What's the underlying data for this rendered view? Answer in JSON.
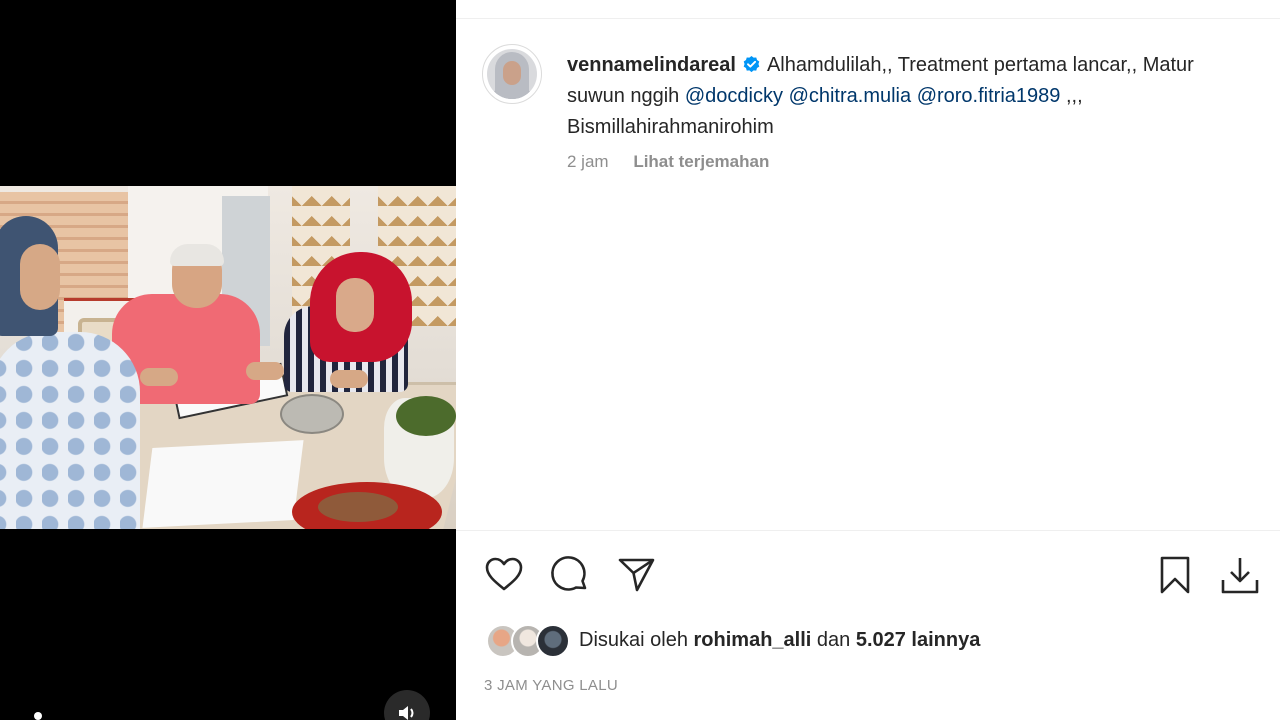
{
  "post": {
    "username": "vennamelindareal",
    "caption_lead": "Alhamdulilah,, Treatment pertama lancar,, Matur suwun nggih",
    "mentions": [
      "@docdicky",
      "@chitra.mulia",
      "@roro.fitria1989"
    ],
    "caption_tail": ",,, Bismillahirahmanirohim",
    "time_ago": "2 jam",
    "translate_label": "Lihat terjemahan"
  },
  "likes": {
    "prefix": "Disukai oleh",
    "user": "rohimah_alli",
    "connector": "dan",
    "count_text": "5.027 lainnya"
  },
  "timestamp": "3 JAM YANG LALU",
  "icons": {
    "like": "heart-icon",
    "comment": "comment-icon",
    "share": "send-icon",
    "save": "bookmark-icon",
    "download": "download-icon",
    "verified": "verified-badge-icon",
    "audio": "speaker-icon"
  },
  "colors": {
    "mention": "#00376b",
    "verified": "#0095f6",
    "muted_text": "#8e8e8e",
    "text": "#262626"
  }
}
